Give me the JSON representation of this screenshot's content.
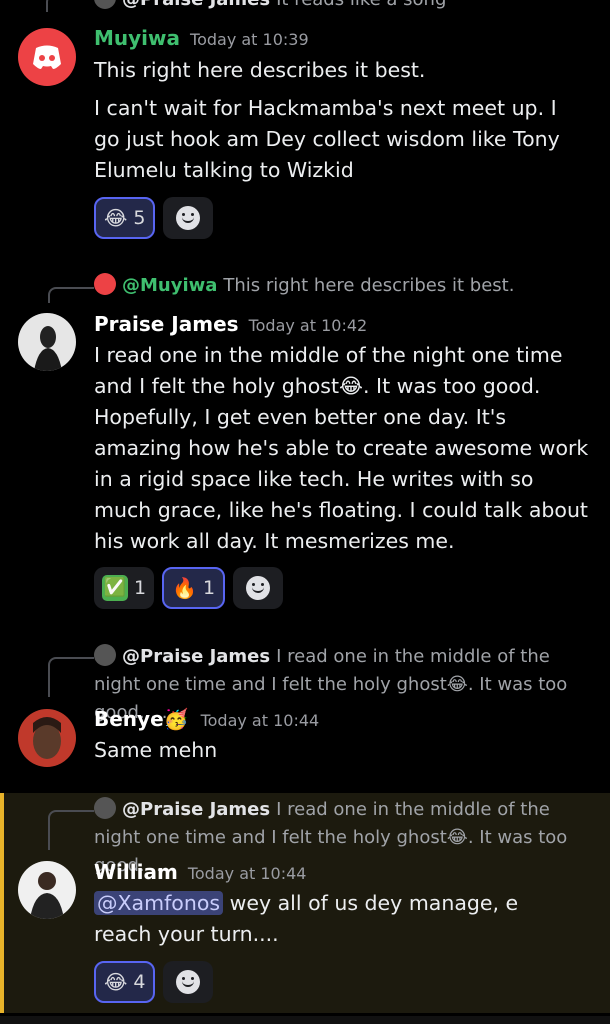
{
  "top_reply": {
    "user": "@Praise James",
    "text": "It reads like a song"
  },
  "messages": [
    {
      "user": "Muyiwa",
      "time": "Today at 10:39",
      "lines": [
        "This right here describes it best.",
        "I can't wait for Hackmamba's next meet up. I go just hook am Dey collect wisdom like Tony Elumelu talking to Wizkid"
      ],
      "reactions": [
        {
          "emoji": "😂",
          "count": "5"
        }
      ]
    },
    {
      "reply": {
        "user": "@Muyiwa",
        "text": "This right here describes it best."
      },
      "user": "Praise James",
      "time": "Today at 10:42",
      "text_before_emoji": "I read one in the middle of the night  one time and I felt the holy ghost",
      "emoji": "😂",
      "text_after_emoji": ". It was too good. Hopefully, I get even better one day. It's amazing how he's able to create awesome work in a rigid space like tech. He writes with so much grace, like he's floating. I could talk about his work all day. It mesmerizes me.",
      "reactions": [
        {
          "emoji": "✅",
          "count": "1"
        },
        {
          "emoji": "🔥",
          "count": "1"
        }
      ]
    },
    {
      "reply": {
        "user": "@Praise James",
        "text_before_emoji": "I read one in the middle of the night one time and I felt the holy ghost",
        "emoji": "😂",
        "text_after_emoji": ". It was too good. ..."
      },
      "user": "Benye",
      "user_emoji": "🥳",
      "time": "Today at 10:44",
      "text": "Same mehn"
    },
    {
      "reply": {
        "user": "@Praise James",
        "text_before_emoji": "I read one in the middle of the night one time and I felt the holy ghost",
        "emoji": "😂",
        "text_after_emoji": ". It was too good. ..."
      },
      "user": "William",
      "time": "Today at 10:44",
      "mention": "@Xamfonos",
      "text": " wey all of us dey manage, e reach your turn....",
      "reactions": [
        {
          "emoji": "😂",
          "count": "4"
        }
      ]
    }
  ],
  "colors": {
    "accent": "#5865f2",
    "highlight_bar": "#e8b32a",
    "discord_red": "#ed4245",
    "green_name": "#3fbf6f"
  },
  "icons": [
    "discord-icon",
    "add-reaction-icon"
  ]
}
